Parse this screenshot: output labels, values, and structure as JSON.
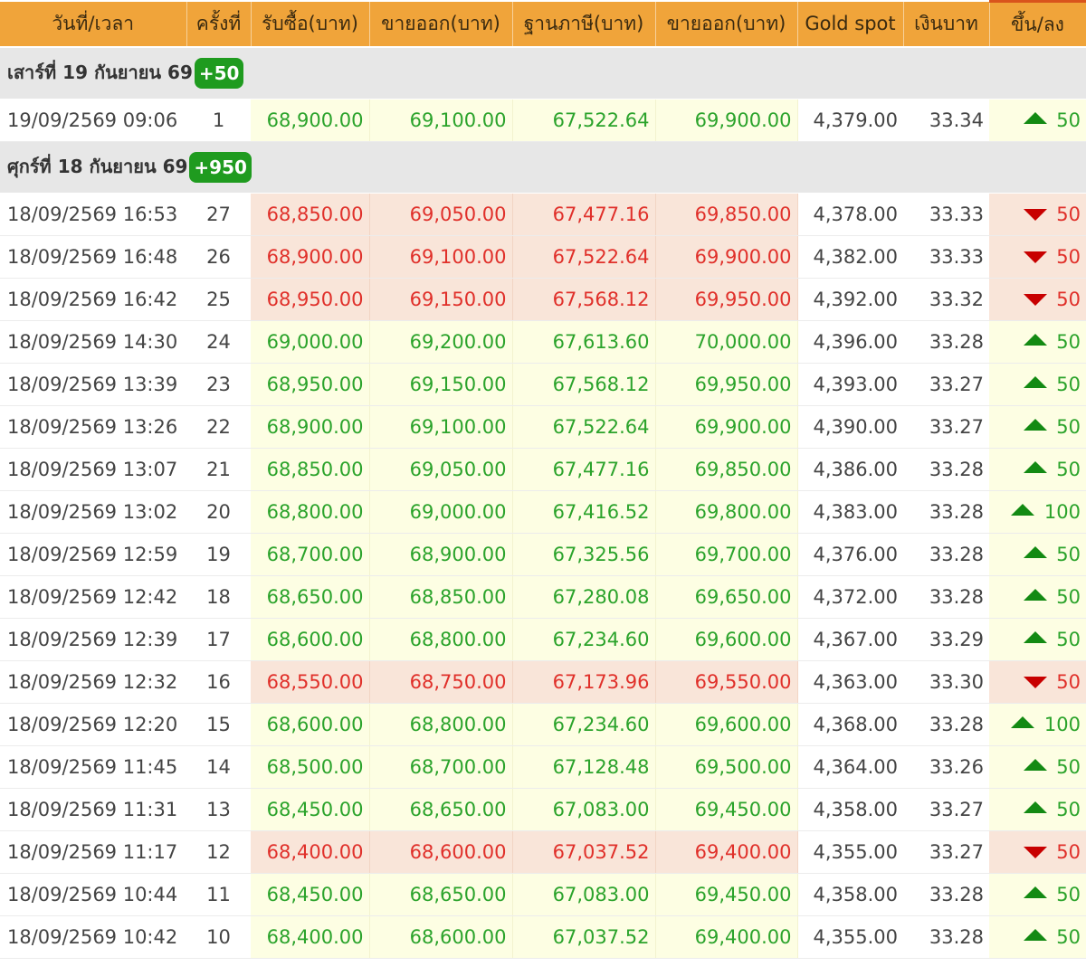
{
  "headers": [
    "วันที่/เวลา",
    "ครั้งที่",
    "รับซื้อ(บาท)",
    "ขายออก(บาท)",
    "ฐานภาษี(บาท)",
    "ขายออก(บาท)",
    "Gold spot",
    "เงินบาท",
    "ขึ้น/ลง"
  ],
  "colors": {
    "header_bg": "#f0a43a",
    "up_text": "#2ba32b",
    "down_text": "#e0302a",
    "up_bg": "#fdfee3",
    "down_bg": "#f9e5d9",
    "badge": "#1f9b1f"
  },
  "groups": [
    {
      "title": "เสาร์ที่ 19 กันยายน 69",
      "badge": "+50",
      "rows": [
        {
          "datetime": "19/09/2569 09:06",
          "no": "1",
          "buy": "68,900.00",
          "sell": "69,100.00",
          "tax": "67,522.64",
          "sell2": "69,900.00",
          "spot": "4,379.00",
          "thb": "33.34",
          "dir": "up",
          "change": "50"
        }
      ]
    },
    {
      "title": "ศุกร์ที่ 18 กันยายน 69",
      "badge": "+950",
      "rows": [
        {
          "datetime": "18/09/2569 16:53",
          "no": "27",
          "buy": "68,850.00",
          "sell": "69,050.00",
          "tax": "67,477.16",
          "sell2": "69,850.00",
          "spot": "4,378.00",
          "thb": "33.33",
          "dir": "down",
          "change": "50"
        },
        {
          "datetime": "18/09/2569 16:48",
          "no": "26",
          "buy": "68,900.00",
          "sell": "69,100.00",
          "tax": "67,522.64",
          "sell2": "69,900.00",
          "spot": "4,382.00",
          "thb": "33.33",
          "dir": "down",
          "change": "50"
        },
        {
          "datetime": "18/09/2569 16:42",
          "no": "25",
          "buy": "68,950.00",
          "sell": "69,150.00",
          "tax": "67,568.12",
          "sell2": "69,950.00",
          "spot": "4,392.00",
          "thb": "33.32",
          "dir": "down",
          "change": "50"
        },
        {
          "datetime": "18/09/2569 14:30",
          "no": "24",
          "buy": "69,000.00",
          "sell": "69,200.00",
          "tax": "67,613.60",
          "sell2": "70,000.00",
          "spot": "4,396.00",
          "thb": "33.28",
          "dir": "up",
          "change": "50"
        },
        {
          "datetime": "18/09/2569 13:39",
          "no": "23",
          "buy": "68,950.00",
          "sell": "69,150.00",
          "tax": "67,568.12",
          "sell2": "69,950.00",
          "spot": "4,393.00",
          "thb": "33.27",
          "dir": "up",
          "change": "50"
        },
        {
          "datetime": "18/09/2569 13:26",
          "no": "22",
          "buy": "68,900.00",
          "sell": "69,100.00",
          "tax": "67,522.64",
          "sell2": "69,900.00",
          "spot": "4,390.00",
          "thb": "33.27",
          "dir": "up",
          "change": "50"
        },
        {
          "datetime": "18/09/2569 13:07",
          "no": "21",
          "buy": "68,850.00",
          "sell": "69,050.00",
          "tax": "67,477.16",
          "sell2": "69,850.00",
          "spot": "4,386.00",
          "thb": "33.28",
          "dir": "up",
          "change": "50"
        },
        {
          "datetime": "18/09/2569 13:02",
          "no": "20",
          "buy": "68,800.00",
          "sell": "69,000.00",
          "tax": "67,416.52",
          "sell2": "69,800.00",
          "spot": "4,383.00",
          "thb": "33.28",
          "dir": "up",
          "change": "100"
        },
        {
          "datetime": "18/09/2569 12:59",
          "no": "19",
          "buy": "68,700.00",
          "sell": "68,900.00",
          "tax": "67,325.56",
          "sell2": "69,700.00",
          "spot": "4,376.00",
          "thb": "33.28",
          "dir": "up",
          "change": "50"
        },
        {
          "datetime": "18/09/2569 12:42",
          "no": "18",
          "buy": "68,650.00",
          "sell": "68,850.00",
          "tax": "67,280.08",
          "sell2": "69,650.00",
          "spot": "4,372.00",
          "thb": "33.28",
          "dir": "up",
          "change": "50"
        },
        {
          "datetime": "18/09/2569 12:39",
          "no": "17",
          "buy": "68,600.00",
          "sell": "68,800.00",
          "tax": "67,234.60",
          "sell2": "69,600.00",
          "spot": "4,367.00",
          "thb": "33.29",
          "dir": "up",
          "change": "50"
        },
        {
          "datetime": "18/09/2569 12:32",
          "no": "16",
          "buy": "68,550.00",
          "sell": "68,750.00",
          "tax": "67,173.96",
          "sell2": "69,550.00",
          "spot": "4,363.00",
          "thb": "33.30",
          "dir": "down",
          "change": "50"
        },
        {
          "datetime": "18/09/2569 12:20",
          "no": "15",
          "buy": "68,600.00",
          "sell": "68,800.00",
          "tax": "67,234.60",
          "sell2": "69,600.00",
          "spot": "4,368.00",
          "thb": "33.28",
          "dir": "up",
          "change": "100"
        },
        {
          "datetime": "18/09/2569 11:45",
          "no": "14",
          "buy": "68,500.00",
          "sell": "68,700.00",
          "tax": "67,128.48",
          "sell2": "69,500.00",
          "spot": "4,364.00",
          "thb": "33.26",
          "dir": "up",
          "change": "50"
        },
        {
          "datetime": "18/09/2569 11:31",
          "no": "13",
          "buy": "68,450.00",
          "sell": "68,650.00",
          "tax": "67,083.00",
          "sell2": "69,450.00",
          "spot": "4,358.00",
          "thb": "33.27",
          "dir": "up",
          "change": "50"
        },
        {
          "datetime": "18/09/2569 11:17",
          "no": "12",
          "buy": "68,400.00",
          "sell": "68,600.00",
          "tax": "67,037.52",
          "sell2": "69,400.00",
          "spot": "4,355.00",
          "thb": "33.27",
          "dir": "down",
          "change": "50"
        },
        {
          "datetime": "18/09/2569 10:44",
          "no": "11",
          "buy": "68,450.00",
          "sell": "68,650.00",
          "tax": "67,083.00",
          "sell2": "69,450.00",
          "spot": "4,358.00",
          "thb": "33.28",
          "dir": "up",
          "change": "50"
        },
        {
          "datetime": "18/09/2569 10:42",
          "no": "10",
          "buy": "68,400.00",
          "sell": "68,600.00",
          "tax": "67,037.52",
          "sell2": "69,400.00",
          "spot": "4,355.00",
          "thb": "33.28",
          "dir": "up",
          "change": "50"
        }
      ]
    }
  ]
}
